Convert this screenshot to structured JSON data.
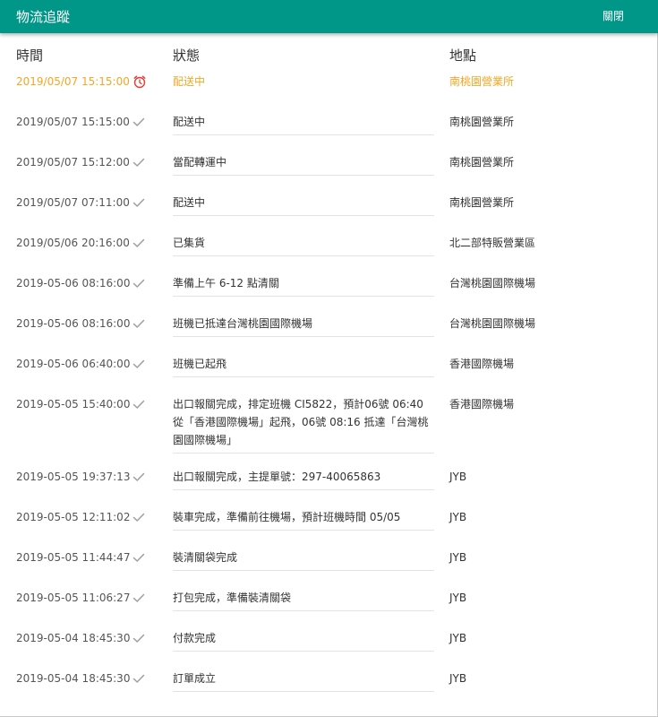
{
  "header": {
    "title": "物流追蹤",
    "close_label": "關閉"
  },
  "columns": {
    "time": "時間",
    "status": "狀態",
    "location": "地點"
  },
  "colors": {
    "header": "#009688",
    "active": "#f5a623",
    "alarm": "#e53935"
  },
  "rows": [
    {
      "time": "2019/05/07 15:15:00",
      "status": "配送中",
      "location": "南桃園營業所",
      "icon": "alarm-clock-icon",
      "active": true
    },
    {
      "time": "2019/05/07 15:15:00",
      "status": "配送中",
      "location": "南桃園營業所",
      "icon": "check-icon"
    },
    {
      "time": "2019/05/07 15:12:00",
      "status": "當配轉運中",
      "location": "南桃園營業所",
      "icon": "check-icon"
    },
    {
      "time": "2019/05/07 07:11:00",
      "status": "配送中",
      "location": "南桃園營業所",
      "icon": "check-icon"
    },
    {
      "time": "2019/05/06 20:16:00",
      "status": "已集貨",
      "location": "北二部特販營業區",
      "icon": "check-icon"
    },
    {
      "time": "2019-05-06 08:16:00",
      "status": "準備上午 6-12 點清關",
      "location": "台灣桃園國際機場",
      "icon": "check-icon"
    },
    {
      "time": "2019-05-06 08:16:00",
      "status": "班機已抵達台灣桃園國際機場",
      "location": "台灣桃園國際機場",
      "icon": "check-icon"
    },
    {
      "time": "2019-05-06 06:40:00",
      "status": "班機已起飛",
      "location": "香港國際機場",
      "icon": "check-icon"
    },
    {
      "time": "2019-05-05 15:40:00",
      "status": "出口報關完成，排定班機 CI5822，預計06號 06:40 從「香港國際機場」起飛，06號 08:16 抵達「台灣桃園國際機場」",
      "location": "香港國際機場",
      "icon": "check-icon"
    },
    {
      "time": "2019-05-05 19:37:13",
      "status": "出口報關完成，主提單號：297-40065863",
      "location": "JYB",
      "icon": "check-icon"
    },
    {
      "time": "2019-05-05 12:11:02",
      "status": "裝車完成，準備前往機場，預計班機時間 05/05",
      "location": "JYB",
      "icon": "check-icon"
    },
    {
      "time": "2019-05-05 11:44:47",
      "status": "裝清關袋完成",
      "location": "JYB",
      "icon": "check-icon"
    },
    {
      "time": "2019-05-05 11:06:27",
      "status": "打包完成，準備裝清關袋",
      "location": "JYB",
      "icon": "check-icon"
    },
    {
      "time": "2019-05-04 18:45:30",
      "status": "付款完成",
      "location": "JYB",
      "icon": "check-icon"
    },
    {
      "time": "2019-05-04 18:45:30",
      "status": "訂單成立",
      "location": "JYB",
      "icon": "check-icon"
    }
  ]
}
